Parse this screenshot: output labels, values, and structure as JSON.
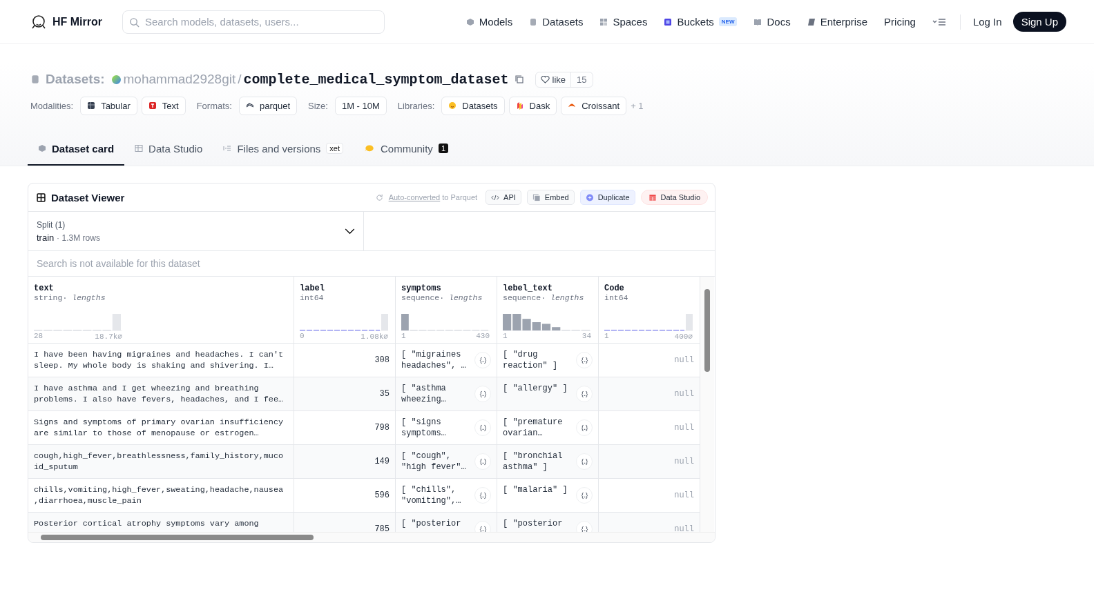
{
  "header": {
    "brand": "HF Mirror",
    "search": {
      "placeholder": "Search models, datasets, users..."
    },
    "nav": [
      {
        "label": "Models",
        "kind": "models"
      },
      {
        "label": "Datasets",
        "kind": "datasets"
      },
      {
        "label": "Spaces",
        "kind": "spaces"
      },
      {
        "label": "Buckets",
        "kind": "buckets",
        "badge": "NEW"
      },
      {
        "label": "Docs",
        "kind": "docs"
      },
      {
        "label": "Enterprise",
        "kind": "enterprise"
      },
      {
        "label": "Pricing",
        "kind": "plain"
      },
      {
        "kind": "more"
      }
    ],
    "login": "Log In",
    "signup": "Sign Up"
  },
  "repo": {
    "type": "Datasets:",
    "owner": "mohammad2928git",
    "separator": "/",
    "name": "complete_medical_symptom_dataset",
    "like": "like",
    "likes": "15"
  },
  "tag_groups": [
    {
      "label": "Modalities:",
      "tags": [
        {
          "label": "Tabular",
          "kind": "tabular"
        },
        {
          "label": "Text",
          "kind": "text"
        }
      ]
    },
    {
      "label": "Formats:",
      "tags": [
        {
          "label": "parquet",
          "kind": "parquet"
        }
      ]
    },
    {
      "label": "Size:",
      "tags": [
        {
          "label": "1M - 10M",
          "kind": "plain"
        }
      ]
    },
    {
      "label": "Libraries:",
      "tags": [
        {
          "label": "Datasets",
          "kind": "hf"
        },
        {
          "label": "Dask",
          "kind": "dask"
        },
        {
          "label": "Croissant",
          "kind": "croissant"
        }
      ],
      "more": "+ 1"
    }
  ],
  "tabs": [
    {
      "label": "Dataset card",
      "kind": "card",
      "selected": true
    },
    {
      "label": "Data Studio",
      "kind": "studio",
      "selected": false
    },
    {
      "label": "Files and versions",
      "kind": "files",
      "selected": false,
      "badge": "xet"
    },
    {
      "label": "Community",
      "kind": "community",
      "selected": false,
      "count": "1"
    }
  ],
  "viewer": {
    "title": "Dataset Viewer",
    "converted_link": "Auto-converted",
    "converted_rest": "to Parquet",
    "actions": [
      {
        "label": "API",
        "kind": "api"
      },
      {
        "label": "Embed",
        "kind": "embed"
      },
      {
        "label": "Duplicate",
        "kind": "duplicate"
      },
      {
        "label": "Data Studio",
        "kind": "studio"
      }
    ],
    "split": {
      "label": "Split (1)",
      "value": "train",
      "separator": "·",
      "rows": "1.3M rows"
    },
    "search_note": "Search is not available for this dataset",
    "columns": [
      {
        "name": "text",
        "type": "string",
        "stat_separator": "·",
        "stat": "lengths",
        "kind": "lengths",
        "min": "28",
        "max": "18.7k",
        "null_mark": "⌀"
      },
      {
        "name": "label",
        "type": "int64",
        "kind": "ints",
        "min": "0",
        "max": "1.08k",
        "null_mark": "⌀"
      },
      {
        "name": "symptoms",
        "type": "sequence",
        "stat_separator": "·",
        "stat": "lengths",
        "kind": "lengths",
        "min": "1",
        "max": "430"
      },
      {
        "name": "lebel_text",
        "type": "sequence",
        "stat_separator": "·",
        "stat": "lengths",
        "kind": "lengths",
        "min": "1",
        "max": "34"
      },
      {
        "name": "Code",
        "type": "int64",
        "kind": "ints",
        "min": "1",
        "max": "400",
        "null_mark": "⌀"
      }
    ],
    "rows": [
      {
        "text": "I have been having migraines and headaches. I can't\nsleep. My whole body is shaking and shivering. I…",
        "label": "308",
        "symptoms": "[ \"migraines\nheadaches\", …",
        "lebel_text": "[ \"drug\nreaction\" ]",
        "code": "null"
      },
      {
        "text": "I have asthma and I get wheezing and breathing\nproblems. I also have fevers, headaches, and I fee…",
        "label": "35",
        "symptoms": "[ \"asthma\nwheezing…",
        "lebel_text": "[ \"allergy\" ]",
        "code": "null"
      },
      {
        "text": "Signs and symptoms of primary ovarian insufficiency\nare similar to those of menopause or estrogen…",
        "label": "798",
        "symptoms": "[ \"signs\nsymptoms…",
        "lebel_text": "[ \"premature\novarian…",
        "code": "null"
      },
      {
        "text": "cough,high_fever,breathlessness,family_history,muco\nid_sputum",
        "label": "149",
        "symptoms": "[ \"cough\",\n\"high fever\"…",
        "lebel_text": "[ \"bronchial\nasthma\" ]",
        "code": "null"
      },
      {
        "text": "chills,vomiting,high_fever,sweating,headache,nausea\n,diarrhoea,muscle_pain",
        "label": "596",
        "symptoms": "[ \"chills\",\n\"vomiting\",…",
        "lebel_text": "[ \"malaria\" ]",
        "code": "null"
      },
      {
        "text": "Posterior cortical atrophy symptoms vary among",
        "label": "785",
        "symptoms": "[ \"posterior",
        "lebel_text": "[ \"posterior",
        "code": "null"
      }
    ]
  }
}
